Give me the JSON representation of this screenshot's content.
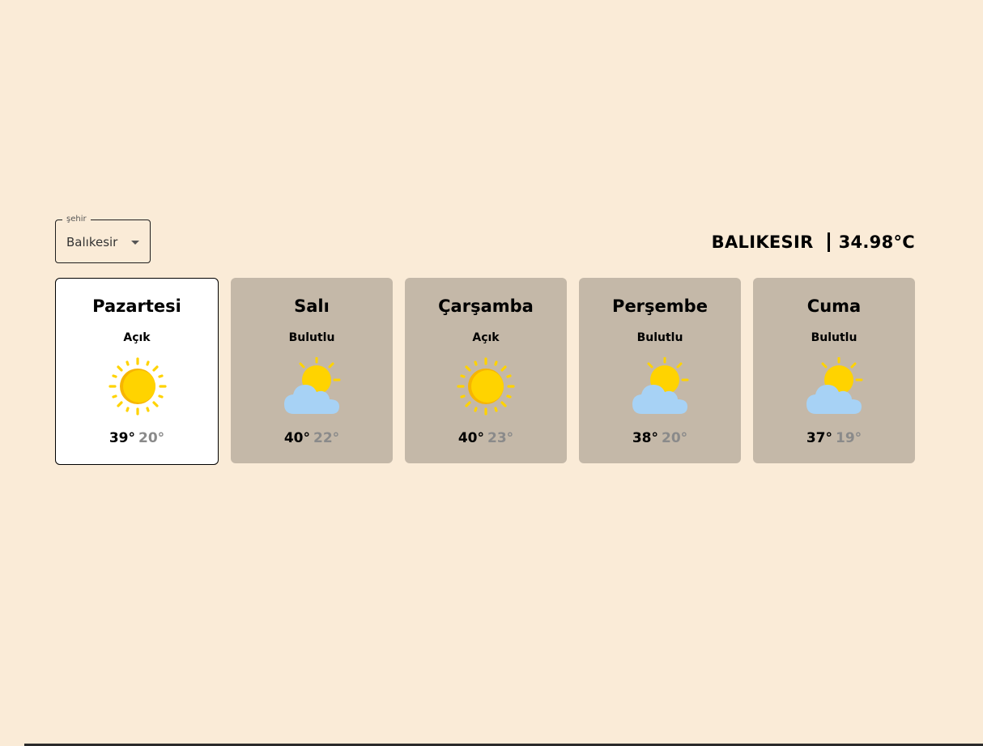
{
  "city_select": {
    "legend": "şehir",
    "value": "Balıkesir"
  },
  "current": {
    "city": "BALIKESIR",
    "temperature": "34.98°C"
  },
  "forecast": [
    {
      "day": "Pazartesi",
      "condition": "Açık",
      "icon": "sun-icon",
      "high": "39°",
      "low": "20°",
      "selected": true
    },
    {
      "day": "Salı",
      "condition": "Bulutlu",
      "icon": "partly-cloudy-icon",
      "high": "40°",
      "low": "22°",
      "selected": false
    },
    {
      "day": "Çarşamba",
      "condition": "Açık",
      "icon": "sun-icon",
      "high": "40°",
      "low": "23°",
      "selected": false
    },
    {
      "day": "Perşembe",
      "condition": "Bulutlu",
      "icon": "partly-cloudy-icon",
      "high": "38°",
      "low": "20°",
      "selected": false
    },
    {
      "day": "Cuma",
      "condition": "Bulutlu",
      "icon": "partly-cloudy-icon",
      "high": "37°",
      "low": "19°",
      "selected": false
    }
  ],
  "colors": {
    "background": "#faebd7",
    "card": "#c4b8a8",
    "card_selected": "#ffffff",
    "sun": "#ffd300",
    "sun_shade": "#f7b500",
    "cloud": "#a7d2f5",
    "low_temp": "#8a8a8a"
  }
}
